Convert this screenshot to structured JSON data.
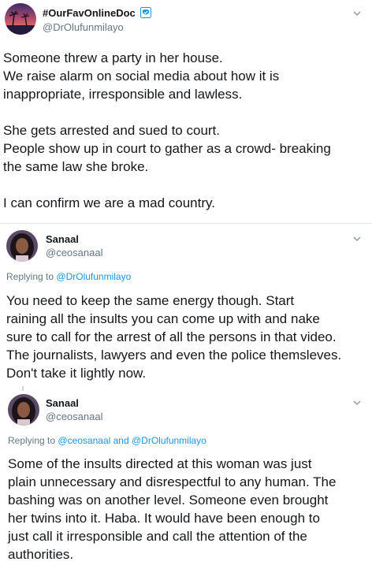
{
  "tweet1": {
    "display_name": "#OurFavOnlineDoc",
    "handle": "@DrOlufunmilayo",
    "verified_icon": "verified-badge-icon",
    "body_lines": [
      "Someone threw a party in her house.",
      "We raise alarm on social media about how it is",
      "inappropriate, irresponsible and lawless.",
      "",
      "She gets arrested and sued to court.",
      "People show up in court to gather as a crowd- breaking",
      "the same law she broke.",
      "",
      "I can confirm we are a mad country."
    ]
  },
  "tweet2": {
    "display_name": "Sanaal",
    "handle": "@ceosanaal",
    "replying_prefix": "Replying to",
    "replying_mentions": "@DrOlufunmilayo",
    "body_lines": [
      "You need to keep the same energy though. Start",
      "raining all the insults you can come up with and nake",
      "sure to call for the arrest of all the persons in that video.",
      "The journalists, lawyers and even the police themsleves.",
      "Don't take it lightly now."
    ]
  },
  "tweet3": {
    "display_name": "Sanaal",
    "handle": "@ceosanaal",
    "replying_prefix": "Replying to",
    "replying_mentions": "@ceosanaal and @DrOlufunmilayo",
    "body_lines": [
      "Some of the insults directed at this woman was just",
      "plain unnecessary and disrespectful to any human. The",
      "bashing was on another level. Someone even brought",
      "her twins into it. Haba. It would have been enough to",
      "just call it irresponsible and call the attention of the",
      "authorities."
    ]
  },
  "colors": {
    "text": "#14171a",
    "secondary": "#657786",
    "link": "#1b95e0",
    "divider": "#e1e8ed"
  },
  "icons": {
    "more": "chevron-down-icon"
  }
}
